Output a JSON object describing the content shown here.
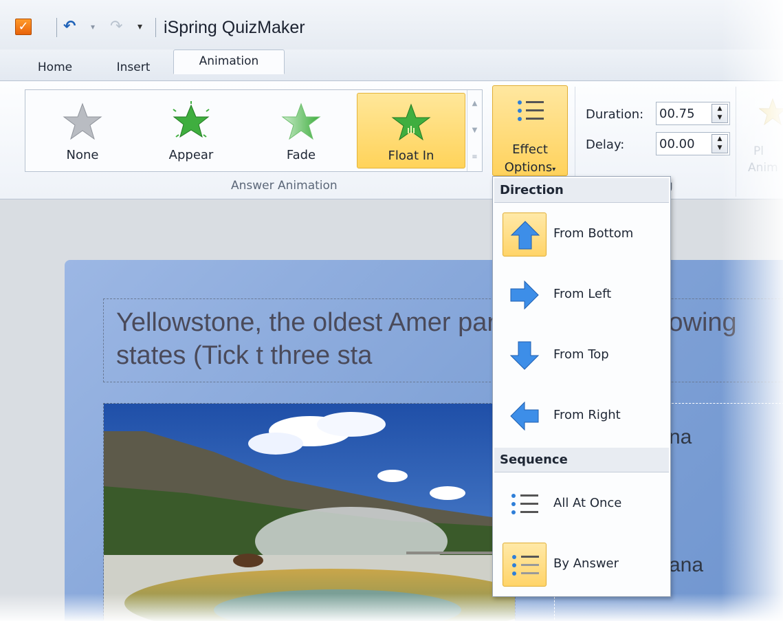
{
  "app": {
    "title": "iSpring QuizMaker"
  },
  "quick_access": {
    "undo_icon": "undo-icon",
    "redo_icon": "redo-icon",
    "more_icon": "customize-qat-icon"
  },
  "tabs": [
    {
      "label": "Home"
    },
    {
      "label": "Insert"
    },
    {
      "label": "Animation"
    }
  ],
  "ribbon": {
    "gallery": [
      {
        "label": "None",
        "icon": "star-gray-icon"
      },
      {
        "label": "Appear",
        "icon": "star-burst-green-icon"
      },
      {
        "label": "Fade",
        "icon": "star-fade-green-icon"
      },
      {
        "label": "Float In",
        "icon": "star-float-green-icon",
        "selected": true
      }
    ],
    "answer_group_label": "Answer Animation",
    "effect_options": {
      "line1": "Effect",
      "line2": "Options"
    },
    "duration": {
      "label": "Duration:",
      "value": "00.75"
    },
    "delay": {
      "label": "Delay:",
      "value": "00.00"
    },
    "timing_group_label": "g",
    "play": {
      "line1": "Pl",
      "line2": "Anim"
    }
  },
  "slide": {
    "question": "Yellowstone, the oldest Amer              park, is l of the following states (Tick t                    three sta",
    "answers": [
      {
        "text": "na"
      },
      {
        "text": "ana"
      }
    ]
  },
  "menu": {
    "direction_header": "Direction",
    "directions": [
      {
        "label": "From Bottom",
        "icon": "arrow-up-icon",
        "selected": true
      },
      {
        "label": "From Left",
        "icon": "arrow-right-icon",
        "selected": false
      },
      {
        "label": "From Top",
        "icon": "arrow-down-icon",
        "selected": false
      },
      {
        "label": "From Right",
        "icon": "arrow-left-icon",
        "selected": false
      }
    ],
    "sequence_header": "Sequence",
    "sequences": [
      {
        "label": "All At Once",
        "icon": "list-bullets-icon",
        "selected": false
      },
      {
        "label": "By Answer",
        "icon": "list-bullets-icon",
        "selected": true
      }
    ]
  },
  "colors": {
    "accent_orange": "#e8620a",
    "highlight": "#ffd35a",
    "arrow_blue": "#3d8ee8",
    "star_green": "#3fae3f"
  }
}
